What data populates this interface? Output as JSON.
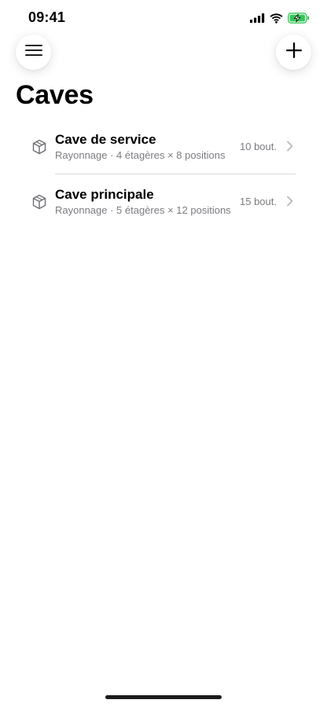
{
  "status_bar": {
    "time": "09:41",
    "icons": [
      "cellular-signal-icon",
      "wifi-icon",
      "battery-charging-icon"
    ],
    "battery_color": "#34c759"
  },
  "header": {
    "menu_icon": "hamburger-menu-icon",
    "add_icon": "plus-icon",
    "title": "Caves"
  },
  "cellars": [
    {
      "icon": "box-icon",
      "name": "Cave de service",
      "details": "Rayonnage · 4 étagères × 8 positions",
      "count": "10 bout."
    },
    {
      "icon": "box-icon",
      "name": "Cave principale",
      "details": "Rayonnage · 5 étagères × 12 positions",
      "count": "15 bout."
    }
  ],
  "colors": {
    "background": "#ffffff",
    "secondary_text": "#7b7b80",
    "divider": "#dcdcdf",
    "chevron": "#b8b8bd"
  }
}
